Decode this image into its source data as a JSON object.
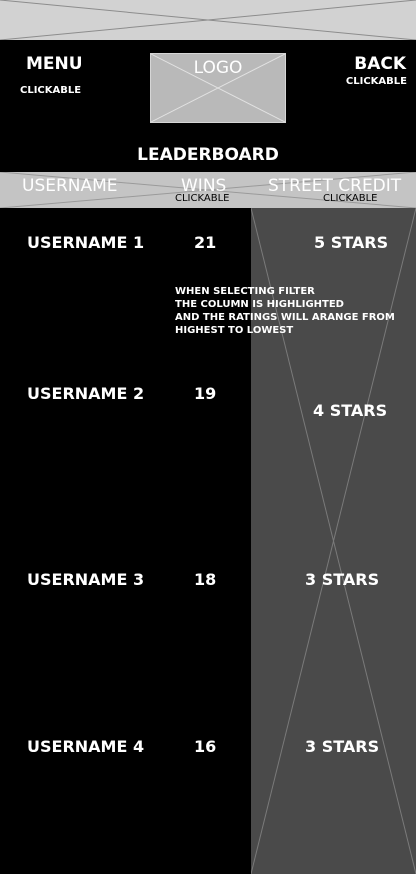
{
  "header": {
    "menu_label": "MENU",
    "menu_note": "CLICKABLE",
    "logo_label": "LOGO",
    "back_label": "BACK",
    "back_note": "CLICKABLE",
    "title": "LEADERBOARD"
  },
  "columns": {
    "username": "USERNAME",
    "wins": "WINS",
    "wins_note": "CLICKABLE",
    "credit": "STREET CREDIT",
    "credit_note": "CLICKABLE"
  },
  "filter_note": [
    "WHEN SELECTING FILTER",
    "THE COLUMN IS HIGHLIGHTED",
    "AND  THE RATINGS  WILL ARANGE FROM",
    "HIGHEST TO LOWEST"
  ],
  "rows": [
    {
      "username": "USERNAME 1",
      "wins": "21",
      "credit": "5 STARS",
      "stars": 5
    },
    {
      "username": "USERNAME 2",
      "wins": "19",
      "credit": "4 STARS",
      "stars": 4
    },
    {
      "username": "USERNAME 3",
      "wins": "18",
      "credit": "3 STARS",
      "stars": 3
    },
    {
      "username": "USERNAME 4",
      "wins": "16",
      "credit": "3 STARS",
      "stars": 3
    }
  ],
  "colors": {
    "background": "#000000",
    "placeholder_gray": "#c4c4c4",
    "highlight_column": "#4a4a4a",
    "text": "#ffffff"
  }
}
